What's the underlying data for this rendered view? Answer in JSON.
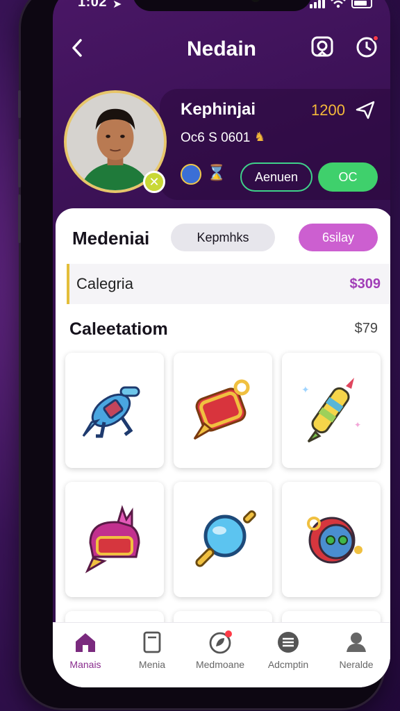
{
  "status": {
    "time": "1:02"
  },
  "header": {
    "title": "Nedain"
  },
  "profile": {
    "name": "Kephinjai",
    "score": "1200",
    "subtitle": "Oc6 S 0601",
    "button_outline": "Aenuen",
    "button_primary": "OC"
  },
  "section": {
    "title": "Medeniai",
    "pill_grey": "Kepmhks",
    "pill_pink": "6silay"
  },
  "category": {
    "label": "Calegria",
    "price": "$309"
  },
  "subsection": {
    "title": "Caleetatiom",
    "price": "$79"
  },
  "items": [
    {
      "icon": "blaster-icon"
    },
    {
      "icon": "chest-icon"
    },
    {
      "icon": "rocket-pencil-icon"
    },
    {
      "icon": "helmet-icon"
    },
    {
      "icon": "magnifier-icon"
    },
    {
      "icon": "drum-robot-icon"
    }
  ],
  "tabs": [
    {
      "label": "Manais",
      "icon": "home-icon",
      "active": true
    },
    {
      "label": "Menia",
      "icon": "book-icon",
      "active": false
    },
    {
      "label": "Medmoane",
      "icon": "leaf-badge-icon",
      "active": false
    },
    {
      "label": "Adcmptin",
      "icon": "list-circle-icon",
      "active": false
    },
    {
      "label": "Neralde",
      "icon": "profile-icon",
      "active": false
    }
  ],
  "colors": {
    "accent_pink": "#cc5fd0",
    "accent_green": "#3fd06c",
    "gold": "#f4b93a",
    "tab_active": "#8a2d8e"
  }
}
